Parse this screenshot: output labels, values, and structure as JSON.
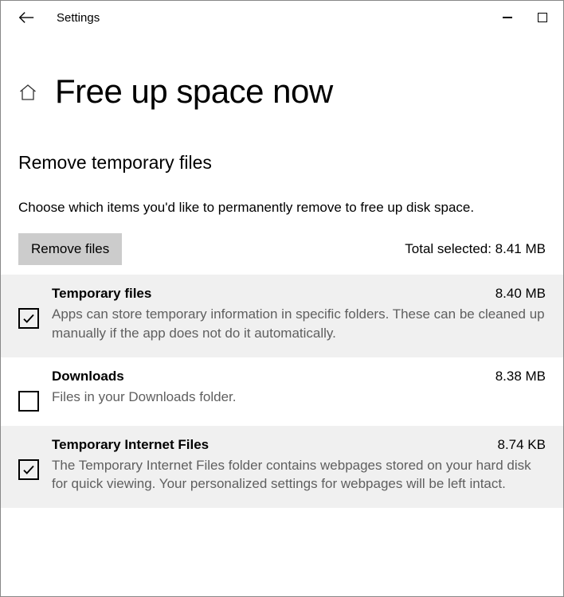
{
  "titlebar": {
    "app_title": "Settings"
  },
  "page": {
    "title": "Free up space now",
    "section_title": "Remove temporary files",
    "section_desc": "Choose which items you'd like to permanently remove to free up disk space.",
    "remove_button": "Remove files",
    "total_selected_label": "Total selected: 8.41 MB"
  },
  "items": [
    {
      "title": "Temporary files",
      "size": "8.40 MB",
      "desc": "Apps can store temporary information in specific folders. These can be cleaned up manually if the app does not do it automatically.",
      "checked": true
    },
    {
      "title": "Downloads",
      "size": "8.38 MB",
      "desc": "Files in your Downloads folder.",
      "checked": false
    },
    {
      "title": "Temporary Internet Files",
      "size": "8.74 KB",
      "desc": "The Temporary Internet Files folder contains webpages stored on your hard disk for quick viewing. Your personalized settings for webpages will be left intact.",
      "checked": true
    }
  ]
}
